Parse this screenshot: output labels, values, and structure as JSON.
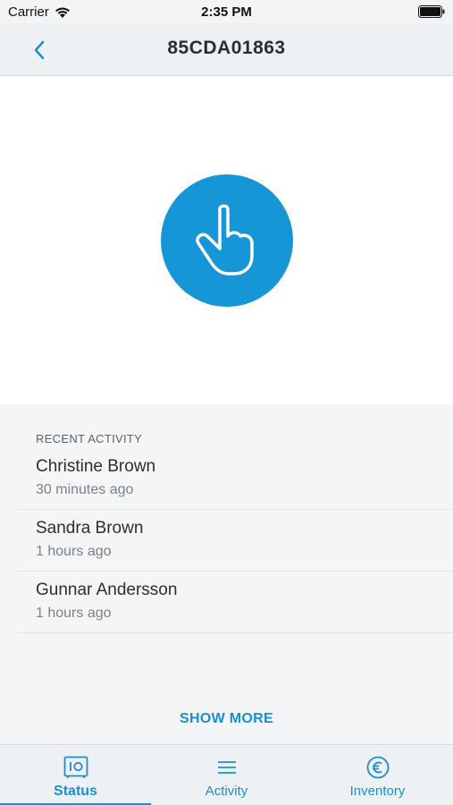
{
  "status_bar": {
    "carrier": "Carrier",
    "time": "2:35 PM"
  },
  "nav": {
    "title": "85CDA01863",
    "back_icon": "chevron-left-icon"
  },
  "hero": {
    "icon": "tap-hand-icon",
    "color": "#1696d6"
  },
  "recent_activity": {
    "header": "RECENT ACTIVITY",
    "items": [
      {
        "name": "Christine Brown",
        "time": "30 minutes ago"
      },
      {
        "name": "Sandra Brown",
        "time": "1 hours ago"
      },
      {
        "name": "Gunnar Andersson",
        "time": "1 hours ago"
      }
    ],
    "show_more": "SHOW MORE"
  },
  "tabs": [
    {
      "label": "Status",
      "icon": "safe-icon",
      "active": true
    },
    {
      "label": "Activity",
      "icon": "list-icon",
      "active": false
    },
    {
      "label": "Inventory",
      "icon": "euro-icon",
      "active": false
    }
  ],
  "colors": {
    "accent": "#1a8fd1",
    "background": "#f3f5f6"
  }
}
